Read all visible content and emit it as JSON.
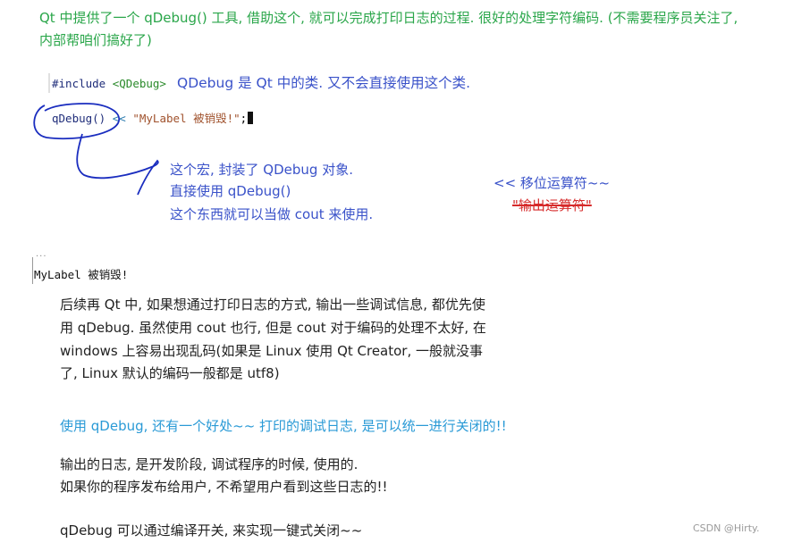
{
  "intro": {
    "line1": "Qt 中提供了一个 qDebug() 工具, 借助这个, 就可以完成打印日志的过程. 很好的处理字符编码. (不需要程序员关注了,",
    "line2": "内部帮咱们搞好了)"
  },
  "code": {
    "include_kw": "#include",
    "include_arg": "<QDebug>",
    "include_note": "QDebug 是 Qt 中的类. 又不会直接使用这个类.",
    "call_fn": "qDebug()",
    "call_op": "<<",
    "call_str": "\"MyLabel 被销毁!\"",
    "call_end": ";"
  },
  "annotations": {
    "macro_line1": "这个宏, 封装了 QDebug 对象.",
    "macro_line2": "直接使用 qDebug()",
    "macro_line3": "这个东西就可以当做 cout 来使用.",
    "shift_op": "<< 移位运算符~~",
    "output_op": "\"输出运算符\""
  },
  "console": {
    "output": "MyLabel 被销毁!"
  },
  "body": {
    "para1_line1": "后续再 Qt 中, 如果想通过打印日志的方式, 输出一些调试信息, 都优先使",
    "para1_line2": "用 qDebug. 虽然使用 cout 也行, 但是 cout 对于编码的处理不太好, 在",
    "para1_line3": "windows 上容易出现乱码(如果是 Linux 使用 Qt Creator, 一般就没事",
    "para1_line4": "了, Linux 默认的编码一般都是 utf8)",
    "highlight": "使用 qDebug, 还有一个好处~~ 打印的调试日志, 是可以统一进行关闭的!!",
    "para2_line1": "输出的日志, 是开发阶段, 调试程序的时候, 使用的.",
    "para2_line2": "如果你的程序发布给用户, 不希望用户看到这些日志的!!",
    "para3": "qDebug 可以通过编译开关, 来实现一键式关闭~~"
  },
  "watermark": "CSDN @Hirty.",
  "colors": {
    "green": "#2aa64a",
    "blue": "#3a52c9",
    "cyan": "#2a9ad6",
    "red": "#d62a2a",
    "ink": "#1a2dbf"
  }
}
